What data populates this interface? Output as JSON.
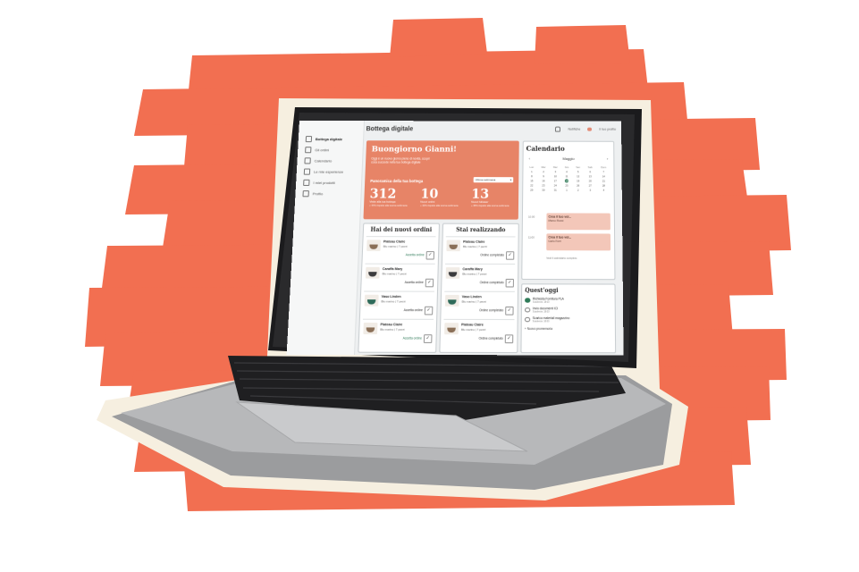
{
  "app": {
    "title": "Bottega digitale"
  },
  "topbar": {
    "notifications": "Notifiche",
    "profile": "Il tuo profilo"
  },
  "sidebar": {
    "items": [
      {
        "label": "Bottega digitale",
        "icon": "store-icon"
      },
      {
        "label": "Gli ordini",
        "icon": "orders-icon"
      },
      {
        "label": "Calendario",
        "icon": "calendar-icon"
      },
      {
        "label": "Le mie esperienze",
        "icon": "experience-icon"
      },
      {
        "label": "I miei prodotti",
        "icon": "products-icon"
      },
      {
        "label": "Profilo",
        "icon": "profile-icon"
      }
    ]
  },
  "welcome": {
    "greeting": "Buongiorno Gianni!",
    "intro": "Oggi è un nuovo giorno pieno di novità, scopri cosa succede nella tua bottega digitale",
    "overview": "Panoramica della tua bottega",
    "period": "Ultima settimana",
    "stats": [
      {
        "value": "312",
        "label": "Visite alla tua bottega",
        "sub": "+ 44% rispetto alla scorsa settimana"
      },
      {
        "value": "10",
        "label": "Nuovi ordini",
        "sub": "+ 33% rispetto alla scorsa settimana"
      },
      {
        "value": "13",
        "label": "Nuovi follower",
        "sub": "+ 35% rispetto alla scorsa settimana"
      }
    ]
  },
  "new_orders": {
    "title": "Hai dei nuovi ordini",
    "items": [
      {
        "name": "Plateau Claire",
        "detail": "Blu marino | 7 pezzi",
        "action": "Accetta ordine"
      },
      {
        "name": "Caraffa Mary",
        "detail": "Blu marino | 7 pezzi",
        "action": "Accetta ordine"
      },
      {
        "name": "Vaso Linden",
        "detail": "Blu marino | 7 pezzi",
        "action": "Accetta ordine"
      },
      {
        "name": "Plateau Claire",
        "detail": "Blu marino | 7 pezzi",
        "action": "Accetta ordine"
      }
    ]
  },
  "in_progress": {
    "title": "Stai realizzando",
    "items": [
      {
        "name": "Plateau Claire",
        "detail": "Blu marino | 7 pezzi",
        "action": "Ordine completato"
      },
      {
        "name": "Caraffa Mary",
        "detail": "Blu marino | 7 pezzi",
        "action": "Ordine completato"
      },
      {
        "name": "Vaso Linden",
        "detail": "Blu marino | 7 pezzi",
        "action": "Ordine completato"
      },
      {
        "name": "Plateau Claire",
        "detail": "Blu marino | 7 pezzi",
        "action": "Ordine completato"
      }
    ]
  },
  "calendar": {
    "title": "Calendario",
    "month": "Maggio",
    "weekdays": [
      "Lun",
      "Mar",
      "Mer",
      "Gio",
      "Ven",
      "Sab",
      "Dom"
    ],
    "weeks": [
      [
        "1",
        "2",
        "3",
        "4",
        "5",
        "6",
        "7"
      ],
      [
        "8",
        "9",
        "10",
        "11",
        "12",
        "13",
        "14"
      ],
      [
        "15",
        "16",
        "17",
        "18",
        "19",
        "20",
        "21"
      ],
      [
        "22",
        "23",
        "24",
        "25",
        "26",
        "27",
        "28"
      ],
      [
        "29",
        "30",
        "31",
        "1",
        "2",
        "3",
        "4"
      ]
    ],
    "today": "18",
    "events": [
      {
        "time": "10:00",
        "title": "Crea il tuo vol...",
        "detail": "Marco Rossi"
      },
      {
        "time": "11:00",
        "title": "Crea il tuo vol...",
        "detail": "Carlo Ferri"
      }
    ],
    "footer": "Vedi il calendario completo"
  },
  "today": {
    "title": "Quest'oggi",
    "tasks": [
      {
        "label": "Richiesta Fornitura PLA",
        "sub": "Scadenza: 18:00",
        "done": true
      },
      {
        "label": "Invio documenti ICI",
        "sub": "Scadenza: 18:00",
        "done": false
      },
      {
        "label": "Scarico materiali magazzino",
        "sub": "Scadenza: 18:00",
        "done": false
      }
    ],
    "new_task": "Nuovo promemoria"
  },
  "colors": {
    "accent": "#e78467",
    "brush": "#f26f51",
    "green": "#2f7a58",
    "event": "#f3c7b9"
  }
}
